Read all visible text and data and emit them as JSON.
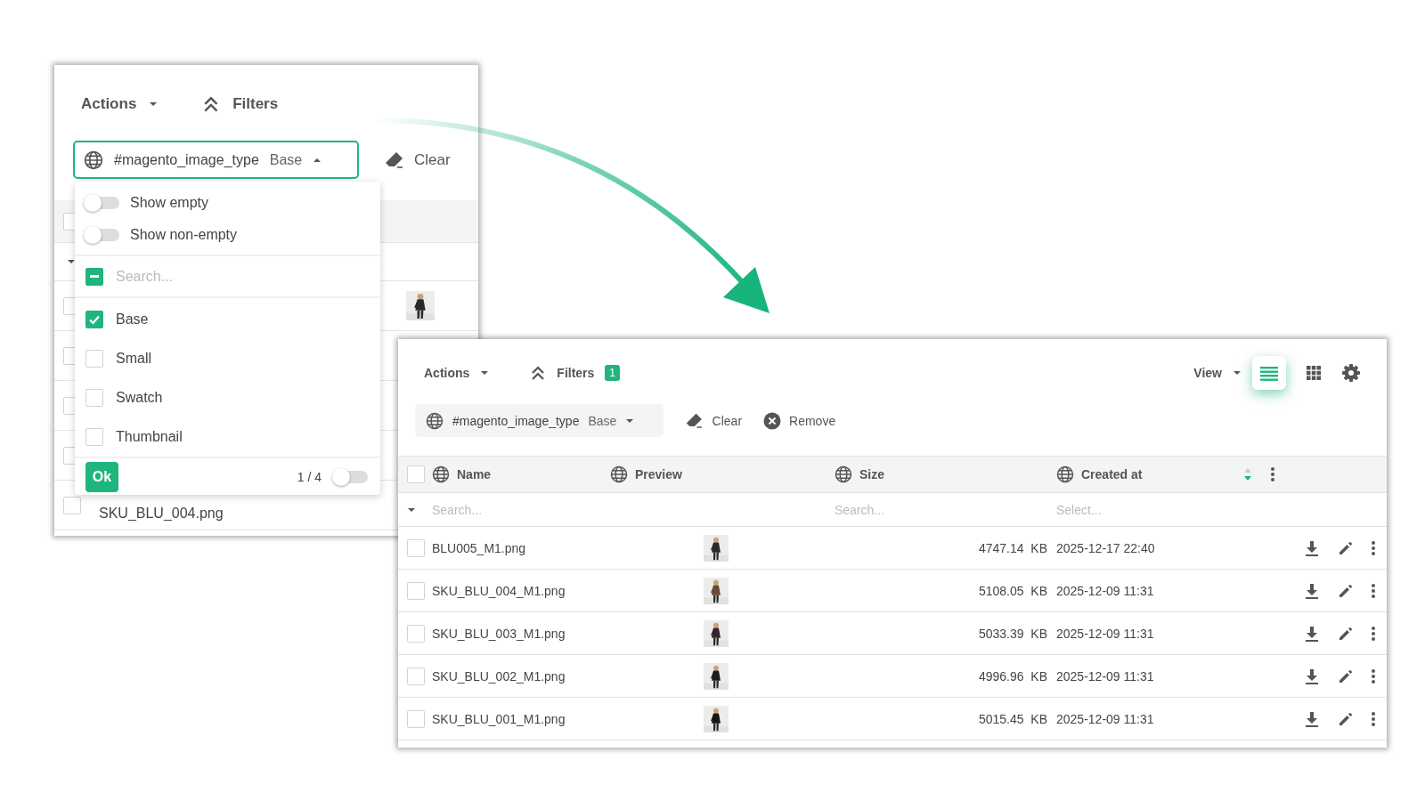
{
  "left_panel": {
    "toolbar": {
      "actions": "Actions",
      "filters": "Filters"
    },
    "filter_chip": {
      "field": "#magento_image_type",
      "value": "Base",
      "expanded": true
    },
    "clear_button": "Clear",
    "background_table": {
      "header_checked": false,
      "rows": [
        {
          "selected": false
        },
        {
          "selected": false
        },
        {
          "selected": false
        },
        {
          "selected": false
        },
        {
          "name": "SKU_BLU_004.png",
          "selected": false
        }
      ]
    },
    "dropdown": {
      "toggles": [
        {
          "label": "Show empty",
          "on": false
        },
        {
          "label": "Show non-empty",
          "on": false
        }
      ],
      "search": {
        "placeholder": "Search...",
        "partially_checked": true
      },
      "options": [
        {
          "label": "Base",
          "checked": true
        },
        {
          "label": "Small",
          "checked": false
        },
        {
          "label": "Swatch",
          "checked": false
        },
        {
          "label": "Thumbnail",
          "checked": false
        }
      ],
      "ok_button": "Ok",
      "count": "1 / 4",
      "footer_toggle_on": false
    }
  },
  "right_panel": {
    "toolbar": {
      "actions": "Actions",
      "filters": "Filters",
      "filter_count": "1",
      "view": "View",
      "view_modes": [
        {
          "kind": "list",
          "selected": true
        },
        {
          "kind": "grid",
          "selected": false
        }
      ]
    },
    "filter_chip": {
      "field": "#magento_image_type",
      "value": "Base",
      "expanded": false
    },
    "clear_button": "Clear",
    "remove_button": "Remove",
    "table": {
      "all_selected": false,
      "columns": [
        {
          "label": "Name",
          "filter_placeholder": "Search..."
        },
        {
          "label": "Preview"
        },
        {
          "label": "Size",
          "filter_placeholder": "Search..."
        },
        {
          "label": "Created at",
          "filter_placeholder": "Select...",
          "sorted": true,
          "sort_descending": true
        }
      ],
      "rows": [
        {
          "name": "BLU005_M1.png",
          "size": "4747.14  KB",
          "created_at": "2025-12-17 22:40",
          "selected": false
        },
        {
          "name": "SKU_BLU_004_M1.png",
          "size": "5108.05  KB",
          "created_at": "2025-12-09 11:31",
          "selected": false
        },
        {
          "name": "SKU_BLU_003_M1.png",
          "size": "5033.39  KB",
          "created_at": "2025-12-09 11:31",
          "selected": false
        },
        {
          "name": "SKU_BLU_002_M1.png",
          "size": "4996.96  KB",
          "created_at": "2025-12-09 11:31",
          "selected": false
        },
        {
          "name": "SKU_BLU_001_M1.png",
          "size": "5015.45  KB",
          "created_at": "2025-12-09 11:31",
          "selected": false
        }
      ]
    }
  }
}
